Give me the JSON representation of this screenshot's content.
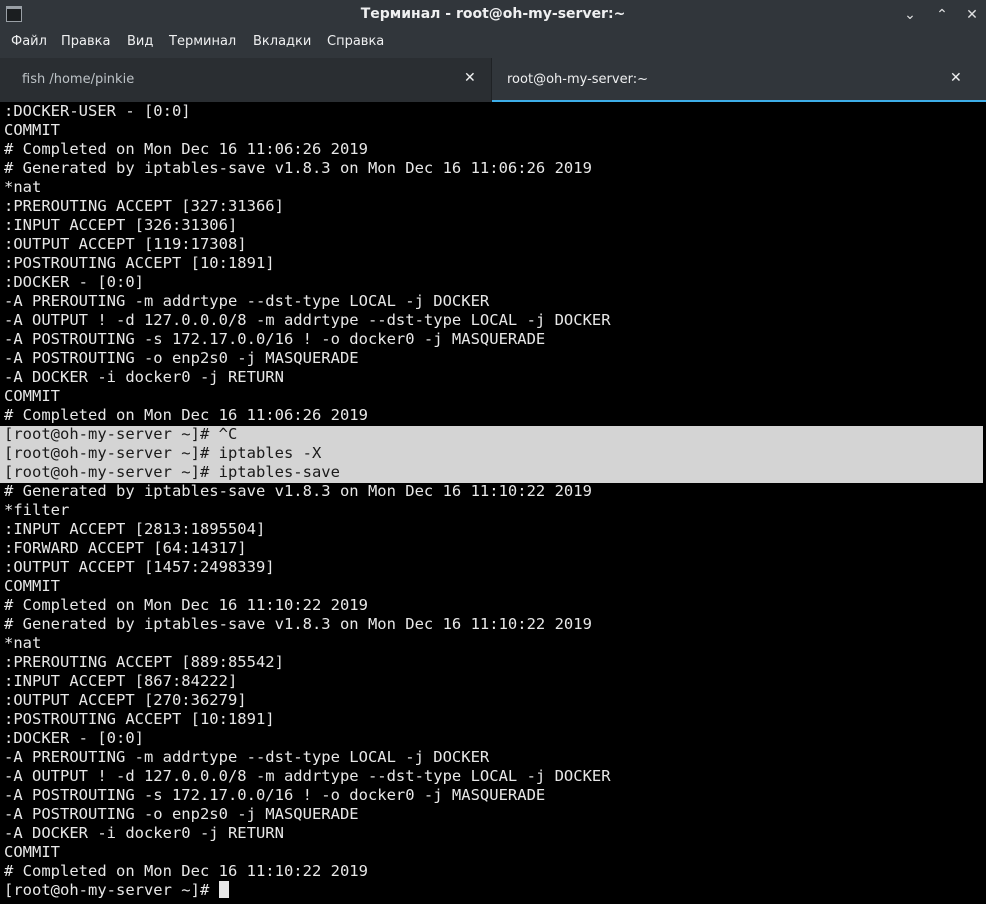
{
  "window": {
    "title": "Терминал - root@oh-my-server:~",
    "minimize_glyph": "⌄",
    "maximize_glyph": "⌃",
    "close_glyph": "✕"
  },
  "menubar": {
    "items": [
      "Файл",
      "Правка",
      "Вид",
      "Терминал",
      "Вкладки",
      "Справка"
    ]
  },
  "tabs": [
    {
      "label": "fish /home/pinkie",
      "close_glyph": "✕",
      "active": false
    },
    {
      "label": "root@oh-my-server:~",
      "close_glyph": "✕",
      "active": true
    }
  ],
  "terminal": {
    "lines": [
      ":DOCKER-USER - [0:0]",
      "COMMIT",
      "# Completed on Mon Dec 16 11:06:26 2019",
      "# Generated by iptables-save v1.8.3 on Mon Dec 16 11:06:26 2019",
      "*nat",
      ":PREROUTING ACCEPT [327:31366]",
      ":INPUT ACCEPT [326:31306]",
      ":OUTPUT ACCEPT [119:17308]",
      ":POSTROUTING ACCEPT [10:1891]",
      ":DOCKER - [0:0]",
      "-A PREROUTING -m addrtype --dst-type LOCAL -j DOCKER",
      "-A OUTPUT ! -d 127.0.0.0/8 -m addrtype --dst-type LOCAL -j DOCKER",
      "-A POSTROUTING -s 172.17.0.0/16 ! -o docker0 -j MASQUERADE",
      "-A POSTROUTING -o enp2s0 -j MASQUERADE",
      "-A DOCKER -i docker0 -j RETURN",
      "COMMIT",
      "# Completed on Mon Dec 16 11:06:26 2019",
      "[root@oh-my-server ~]# ^C",
      "[root@oh-my-server ~]# iptables -X",
      "[root@oh-my-server ~]# iptables-save",
      "# Generated by iptables-save v1.8.3 on Mon Dec 16 11:10:22 2019",
      "*filter",
      ":INPUT ACCEPT [2813:1895504]",
      ":FORWARD ACCEPT [64:14317]",
      ":OUTPUT ACCEPT [1457:2498339]",
      "COMMIT",
      "# Completed on Mon Dec 16 11:10:22 2019",
      "# Generated by iptables-save v1.8.3 on Mon Dec 16 11:10:22 2019",
      "*nat",
      ":PREROUTING ACCEPT [889:85542]",
      ":INPUT ACCEPT [867:84222]",
      ":OUTPUT ACCEPT [270:36279]",
      ":POSTROUTING ACCEPT [10:1891]",
      ":DOCKER - [0:0]",
      "-A PREROUTING -m addrtype --dst-type LOCAL -j DOCKER",
      "-A OUTPUT ! -d 127.0.0.0/8 -m addrtype --dst-type LOCAL -j DOCKER",
      "-A POSTROUTING -s 172.17.0.0/16 ! -o docker0 -j MASQUERADE",
      "-A POSTROUTING -o enp2s0 -j MASQUERADE",
      "-A DOCKER -i docker0 -j RETURN",
      "COMMIT",
      "# Completed on Mon Dec 16 11:10:22 2019"
    ],
    "prompt": "[root@oh-my-server ~]# "
  },
  "colors": {
    "chrome_bg": "#31363b",
    "accent": "#3daee9",
    "terminal_bg": "#000000",
    "terminal_fg": "#e8e8e8",
    "selection_bg": "#d4d4d4"
  }
}
